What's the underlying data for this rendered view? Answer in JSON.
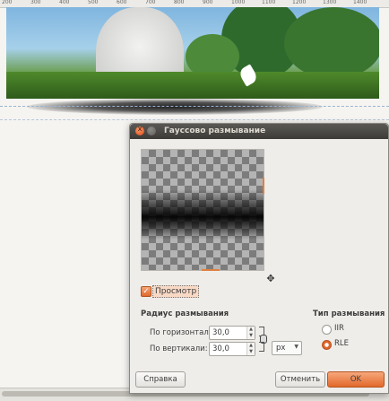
{
  "ruler": {
    "labels": [
      "200",
      "300",
      "400",
      "500",
      "600",
      "700",
      "800",
      "900",
      "1000",
      "1100",
      "1200",
      "1300",
      "1400"
    ]
  },
  "dialog": {
    "title": "Гауссово размывание",
    "close_icon": "x",
    "preview_checkbox": {
      "checked": true,
      "label": "Просмотр"
    },
    "blur_radius": {
      "title": "Радиус размывания",
      "horizontal": {
        "label": "По горизонтали:",
        "value": "30,0"
      },
      "vertical": {
        "label": "По вертикали:",
        "value": "30,0"
      },
      "unit": "px"
    },
    "blur_type": {
      "title": "Тип размывания",
      "options": [
        {
          "label": "IIR",
          "selected": false
        },
        {
          "label": "RLE",
          "selected": true
        }
      ]
    },
    "buttons": {
      "help": "Справка",
      "cancel": "Отменить",
      "ok": "OK"
    }
  },
  "colors": {
    "accent": "#e2692c",
    "titlebar": "#3c3b37",
    "dialog_bg": "#efedea"
  },
  "icons": {
    "navigate": "move-cross-icon",
    "chain": "chain-link-icon"
  }
}
